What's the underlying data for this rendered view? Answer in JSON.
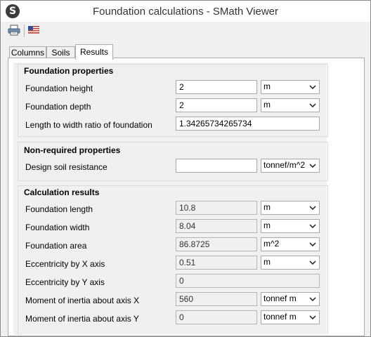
{
  "window": {
    "title": "Foundation calculations - SMath Viewer",
    "app_icon_glyph": "S"
  },
  "toolbar": {
    "print_icon": "printer-icon",
    "language_icon": "us-flag-icon"
  },
  "tabs": [
    {
      "label": "Columns"
    },
    {
      "label": "Soils"
    },
    {
      "label": "Results",
      "active": true
    }
  ],
  "groups": {
    "foundation_properties": {
      "title": "Foundation properties",
      "rows": [
        {
          "label": "Foundation height",
          "value": "2",
          "unit": "m"
        },
        {
          "label": "Foundation depth",
          "value": "2",
          "unit": "m"
        },
        {
          "label": "Length to width ratio of foundation",
          "value": "1.34265734265734"
        }
      ]
    },
    "non_required": {
      "title": "Non-required properties",
      "rows": [
        {
          "label": "Design soil resistance",
          "value": "",
          "unit": "tonnef/m^2"
        }
      ]
    },
    "results": {
      "title": "Calculation results",
      "rows": [
        {
          "label": "Foundation length",
          "value": "10.8",
          "unit": "m"
        },
        {
          "label": "Foundation width",
          "value": "8.04",
          "unit": "m"
        },
        {
          "label": "Foundation area",
          "value": "86.8725",
          "unit": "m^2"
        },
        {
          "label": "Eccentricity by X axis",
          "value": "0.51",
          "unit": "m"
        },
        {
          "label": "Eccentricity by Y axis",
          "value": "0"
        },
        {
          "label": "Moment of inertia about axis X",
          "value": "560",
          "unit": "tonnef m"
        },
        {
          "label": "Moment of inertia about axis Y",
          "value": "0",
          "unit": "tonnef m"
        }
      ]
    }
  }
}
